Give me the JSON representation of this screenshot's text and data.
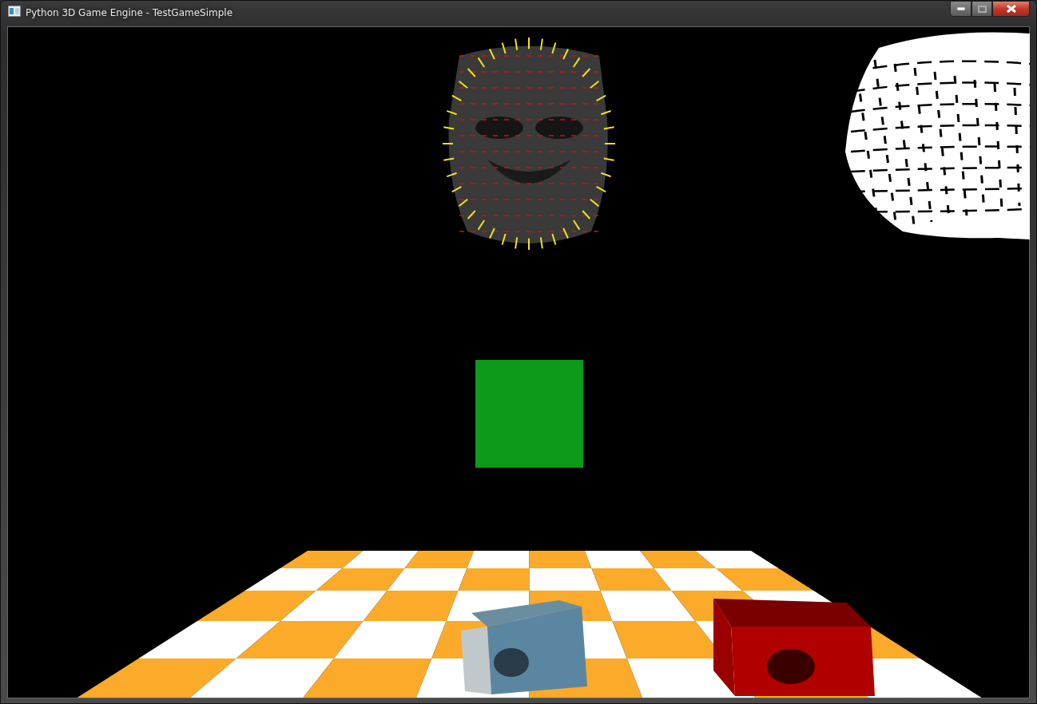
{
  "window": {
    "title": "Python 3D Game Engine - TestGameSimple"
  }
}
